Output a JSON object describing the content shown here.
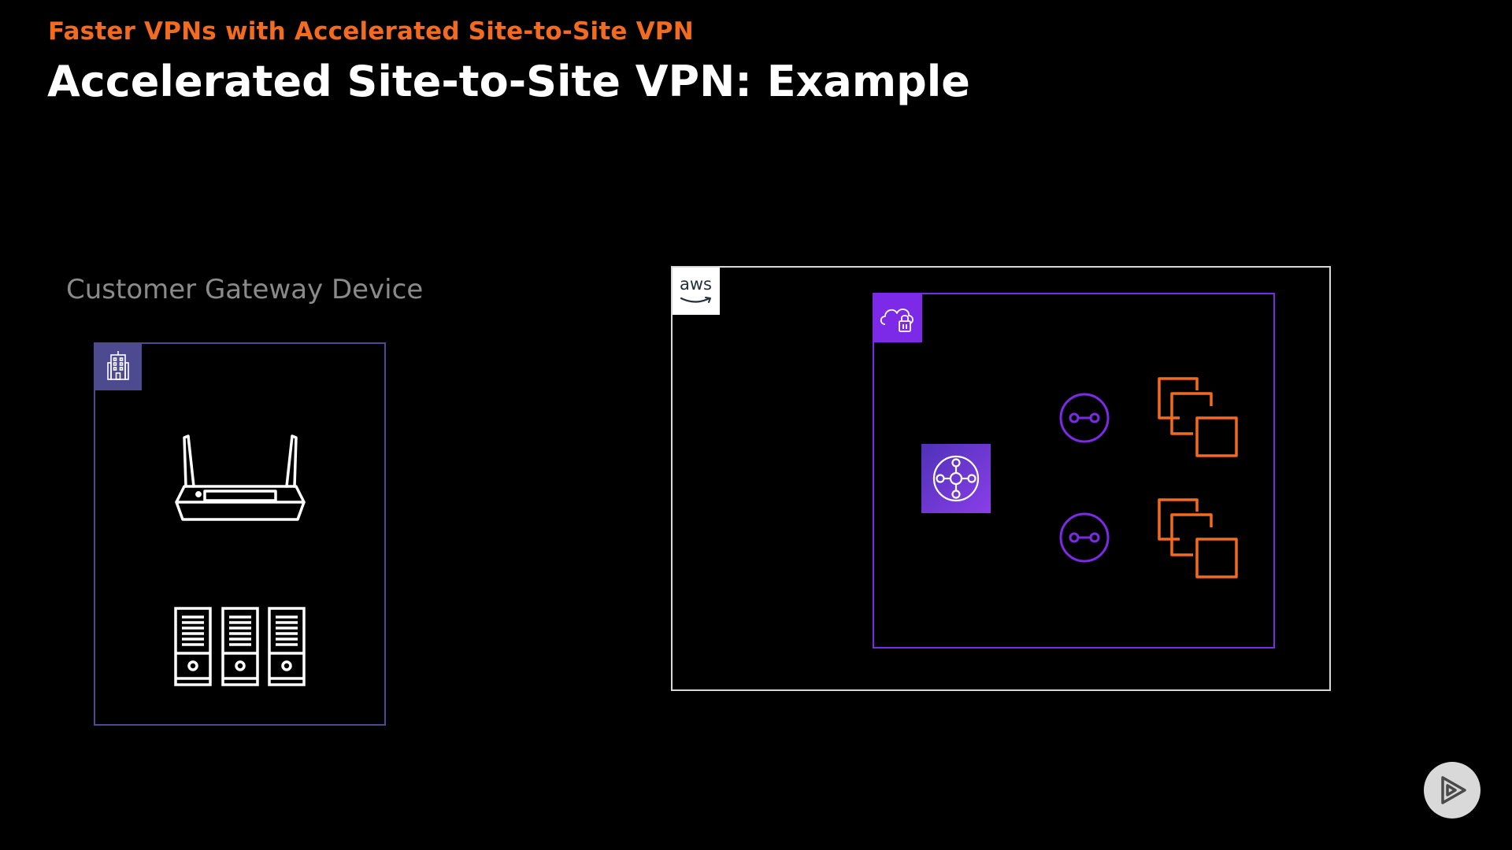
{
  "header": {
    "subtitle": "Faster VPNs with Accelerated Site-to-Site VPN",
    "title": "Accelerated Site-to-Site VPN: Example"
  },
  "customer_gateway": {
    "label": "Customer Gateway Device",
    "badge_icon": "corporate-building-icon",
    "items": [
      "router-icon",
      "server-rack-icon"
    ]
  },
  "aws_cloud": {
    "badge_text": "aws",
    "vpc": {
      "badge_icon": "vpc-cloud-lock-icon",
      "transit_gateway_icon": "transit-gateway-icon",
      "attachments": [
        "vpc-attachment-icon",
        "vpc-attachment-icon"
      ],
      "instance_groups": [
        "ec2-instances-icon",
        "ec2-instances-icon"
      ]
    }
  },
  "colors": {
    "background": "#000000",
    "accent_orange": "#f26b21",
    "customer_border": "#4d4a8f",
    "vpc_purple": "#7d2ae8",
    "aws_border": "#d8d8d8"
  },
  "controls": {
    "play_icon": "play-icon"
  }
}
